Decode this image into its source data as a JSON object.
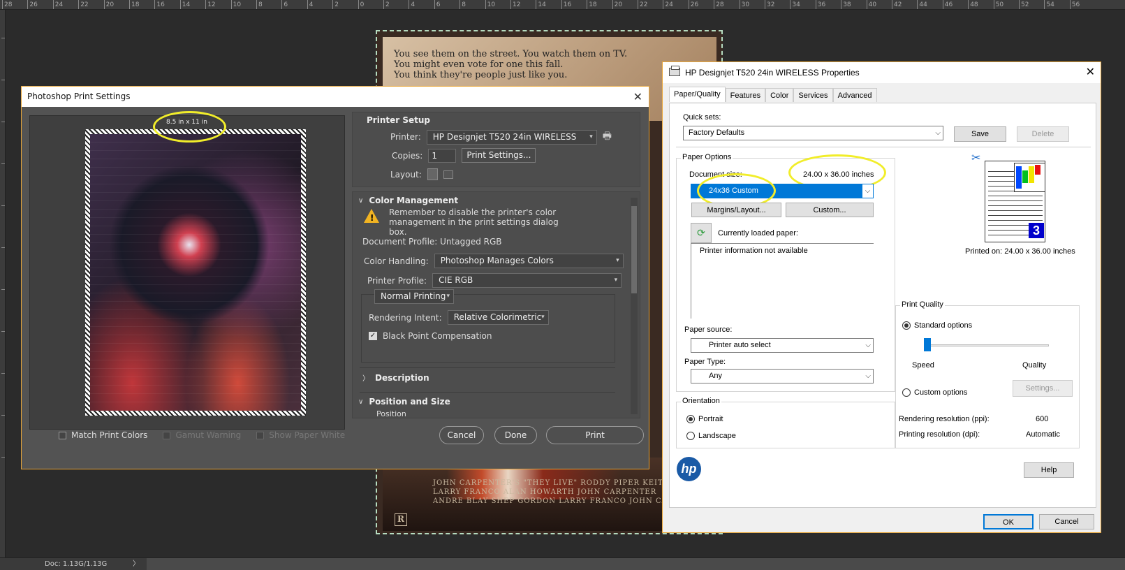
{
  "ruler": {
    "ticks": [
      "28",
      "26",
      "24",
      "22",
      "20",
      "18",
      "16",
      "14",
      "12",
      "10",
      "8",
      "6",
      "4",
      "2",
      "0",
      "2",
      "4",
      "6",
      "8",
      "10",
      "12",
      "14",
      "16",
      "18",
      "20",
      "22",
      "24",
      "26",
      "28",
      "30",
      "32",
      "34",
      "36",
      "38",
      "40",
      "42",
      "44",
      "46",
      "48",
      "50",
      "52",
      "54",
      "56"
    ]
  },
  "status": {
    "doc": "Doc: 1.13G/1.13G",
    "arrow": "〉"
  },
  "poster": {
    "lines": [
      "You see them on the street. You watch them on TV.",
      "You might even vote for one this fall.",
      "You think they're people just like you."
    ],
    "credits": [
      "JOHN CARPENTER'S \"THEY LIVE\" RODDY PIPER KEITH DAVID",
      "LARRY FRANCO ALAN HOWARTH JOHN CARPENTER",
      "ANDRE BLAY SHEP GORDON LARRY FRANCO JOHN CARPENTER"
    ],
    "rating": "R"
  },
  "ps": {
    "title": "Photoshop Print Settings",
    "paper_size": "8.5 in x 11 in",
    "checks": {
      "match": "Match Print Colors",
      "gamut": "Gamut Warning",
      "paper_white": "Show Paper White"
    },
    "printer_setup": {
      "heading": "Printer Setup",
      "printer_label": "Printer:",
      "printer_value": "HP Designjet T520 24in WIRELESS",
      "copies_label": "Copies:",
      "copies_value": "1",
      "print_settings": "Print Settings...",
      "layout_label": "Layout:"
    },
    "color_mgmt": {
      "heading": "Color Management",
      "warning": "Remember to disable the printer's color management in the print settings dialog box.",
      "doc_profile": "Document Profile: Untagged RGB",
      "handling_label": "Color Handling:",
      "handling_value": "Photoshop Manages Colors",
      "profile_label": "Printer Profile:",
      "profile_value": "CIE RGB",
      "mode_value": "Normal Printing",
      "intent_label": "Rendering Intent:",
      "intent_value": "Relative Colorimetric",
      "bpc": "Black Point Compensation"
    },
    "description": "Description",
    "position_size": "Position and Size",
    "position": "Position",
    "buttons": {
      "cancel": "Cancel",
      "done": "Done",
      "print": "Print"
    }
  },
  "hp": {
    "title": "HP Designjet T520 24in WIRELESS Properties",
    "tabs": [
      "Paper/Quality",
      "Features",
      "Color",
      "Services",
      "Advanced"
    ],
    "quick_sets_label": "Quick sets:",
    "quick_sets_value": "Factory Defaults",
    "save": "Save",
    "delete": "Delete",
    "paper_options": "Paper Options",
    "doc_size_label": "Document size:",
    "doc_size_value": "24.00 x 36.00 inches",
    "size_select": "24x36 Custom",
    "margins": "Margins/Layout...",
    "custom": "Custom...",
    "loaded_label": "Currently loaded paper:",
    "printer_info": "Printer information not available",
    "source_label": "Paper source:",
    "source_value": "Printer auto select",
    "type_label": "Paper Type:",
    "type_value": "Any",
    "orientation": "Orientation",
    "portrait": "Portrait",
    "landscape": "Landscape",
    "printed_on": "Printed on: 24.00 x 36.00 inches",
    "quality": {
      "heading": "Print Quality",
      "standard": "Standard options",
      "speed": "Speed",
      "quality": "Quality",
      "custom": "Custom options",
      "settings": "Settings...",
      "render_label": "Rendering resolution (ppi):",
      "render_value": "600",
      "print_label": "Printing resolution (dpi):",
      "print_value": "Automatic"
    },
    "logo": "hp",
    "help": "Help",
    "ok": "OK",
    "cancel": "Cancel"
  }
}
